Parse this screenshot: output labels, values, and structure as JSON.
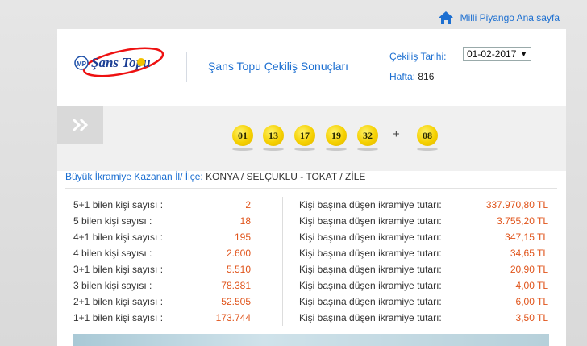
{
  "top_link": {
    "label": "Milli Piyango Ana sayfa",
    "icon": "home-icon"
  },
  "logo": {
    "badge": "MP",
    "text": "Şans Topu"
  },
  "page_title": "Şans Topu Çekiliş Sonuçları",
  "draw": {
    "date_label": "Çekiliş Tarihi:",
    "date_value": "01-02-2017",
    "week_label": "Hafta:",
    "week_value": "816"
  },
  "balls": [
    "01",
    "13",
    "17",
    "19",
    "32"
  ],
  "plus": "+",
  "bonus_ball": "08",
  "winners": {
    "label": "Büyük İkramiye Kazanan İl/ İlçe:",
    "value": "KONYA / SELÇUKLU - TOKAT / ZİLE"
  },
  "results": [
    {
      "label": "5+1 bilen kişi sayısı :",
      "count": "2",
      "prize_label": "Kişi başına düşen ikramiye tutarı:",
      "prize": "337.970,80 TL"
    },
    {
      "label": "5 bilen kişi sayısı :",
      "count": "18",
      "prize_label": "Kişi başına düşen ikramiye tutarı:",
      "prize": "3.755,20 TL"
    },
    {
      "label": "4+1 bilen kişi sayısı :",
      "count": "195",
      "prize_label": "Kişi başına düşen ikramiye tutarı:",
      "prize": "347,15 TL"
    },
    {
      "label": "4 bilen kişi sayısı :",
      "count": "2.600",
      "prize_label": "Kişi başına düşen ikramiye tutarı:",
      "prize": "34,65 TL"
    },
    {
      "label": "3+1 bilen kişi sayısı :",
      "count": "5.510",
      "prize_label": "Kişi başına düşen ikramiye tutarı:",
      "prize": "20,90 TL"
    },
    {
      "label": "3 bilen kişi sayısı :",
      "count": "78.381",
      "prize_label": "Kişi başına düşen ikramiye tutarı:",
      "prize": "4,00 TL"
    },
    {
      "label": "2+1 bilen kişi sayısı :",
      "count": "52.505",
      "prize_label": "Kişi başına düşen ikramiye tutarı:",
      "prize": "6,00 TL"
    },
    {
      "label": "1+1 bilen kişi sayısı :",
      "count": "173.744",
      "prize_label": "Kişi başına düşen ikramiye tutarı:",
      "prize": "3,50 TL"
    }
  ],
  "colors": {
    "link_blue": "#1c6fd1",
    "number_orange": "#e0541b",
    "ball_yellow": "#f5d000"
  }
}
